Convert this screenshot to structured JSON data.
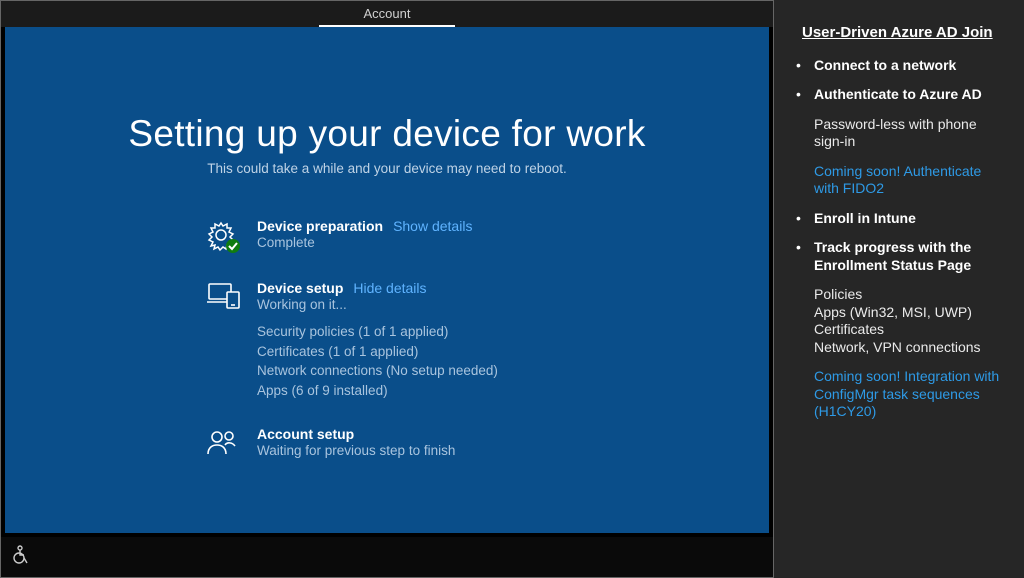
{
  "tab": {
    "label": "Account"
  },
  "oobe": {
    "title": "Setting up your device for work",
    "subtitle": "This could take a while and your device may need to reboot.",
    "step1": {
      "title": "Device preparation",
      "link": "Show details",
      "status": "Complete"
    },
    "step2": {
      "title": "Device setup",
      "link": "Hide details",
      "status": "Working on it...",
      "detail0": "Security policies (1 of 1 applied)",
      "detail1": "Certificates (1 of 1 applied)",
      "detail2": "Network connections (No setup needed)",
      "detail3": "Apps (6 of 9 installed)"
    },
    "step3": {
      "title": "Account setup",
      "status": "Waiting for previous step to finish"
    }
  },
  "sidebar": {
    "title": "User-Driven Azure AD Join",
    "b1": "Connect to a network",
    "b2": "Authenticate to Azure AD",
    "sub1": "Password-less with phone sign-in",
    "link1": "Coming soon!  Authenticate with FIDO2",
    "b3": "Enroll in Intune",
    "b4": "Track progress with the Enrollment Status Page",
    "sub2a": "Policies",
    "sub2b": "Apps (Win32, MSI, UWP)",
    "sub2c": "Certificates",
    "sub2d": "Network, VPN connections",
    "link2": "Coming soon!  Integration with ConfigMgr task sequences (H1CY20)"
  }
}
